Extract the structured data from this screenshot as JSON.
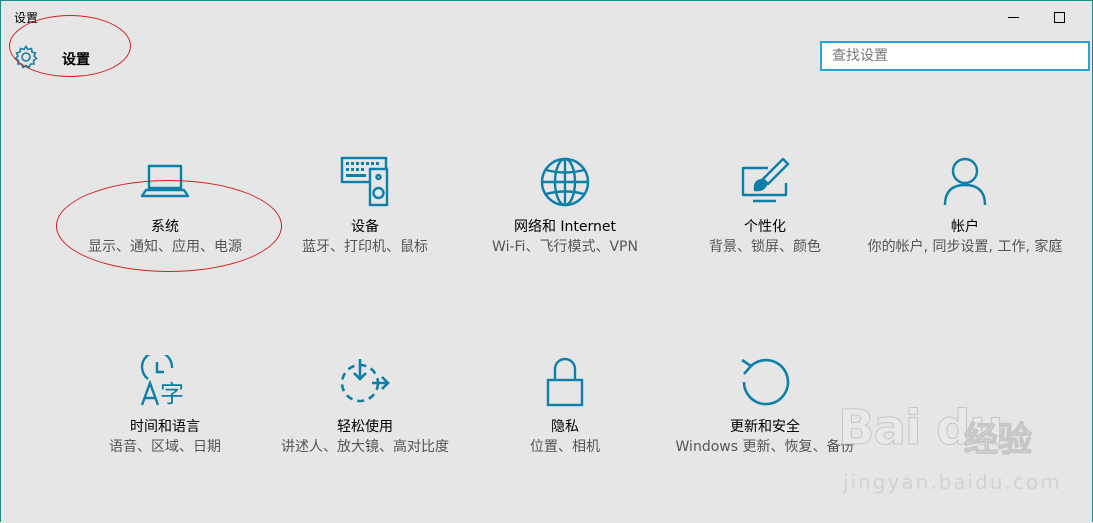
{
  "window": {
    "title": "设置"
  },
  "header": {
    "icon": "gear-icon",
    "title": "设置"
  },
  "search": {
    "placeholder": "查找设置",
    "value": ""
  },
  "tiles": [
    {
      "id": "system",
      "icon": "laptop-icon",
      "title": "系统",
      "desc": "显示、通知、应用、电源"
    },
    {
      "id": "devices",
      "icon": "keyboard-speaker-icon",
      "title": "设备",
      "desc": "蓝牙、打印机、鼠标"
    },
    {
      "id": "network",
      "icon": "globe-icon",
      "title": "网络和 Internet",
      "desc": "Wi-Fi、飞行模式、VPN"
    },
    {
      "id": "personalization",
      "icon": "paintbrush-display-icon",
      "title": "个性化",
      "desc": "背景、锁屏、颜色"
    },
    {
      "id": "accounts",
      "icon": "person-icon",
      "title": "帐户",
      "desc": "你的帐户, 同步设置, 工作, 家庭"
    },
    {
      "id": "time-language",
      "icon": "clock-language-icon",
      "title": "时间和语言",
      "desc": "语音、区域、日期"
    },
    {
      "id": "ease-of-access",
      "icon": "ease-of-access-icon",
      "title": "轻松使用",
      "desc": "讲述人、放大镜、高对比度"
    },
    {
      "id": "privacy",
      "icon": "lock-icon",
      "title": "隐私",
      "desc": "位置、相机"
    },
    {
      "id": "update-security",
      "icon": "refresh-icon",
      "title": "更新和安全",
      "desc": "Windows 更新、恢复、备份"
    }
  ],
  "watermark": {
    "brand": "Bai du",
    "brand_cn": "经验",
    "url": "jingyan.baidu.com"
  },
  "colors": {
    "accent": "#0e7fa8",
    "search_border": "#2aa3d6",
    "annotation": "#d42020",
    "background": "#e6e6e6"
  }
}
